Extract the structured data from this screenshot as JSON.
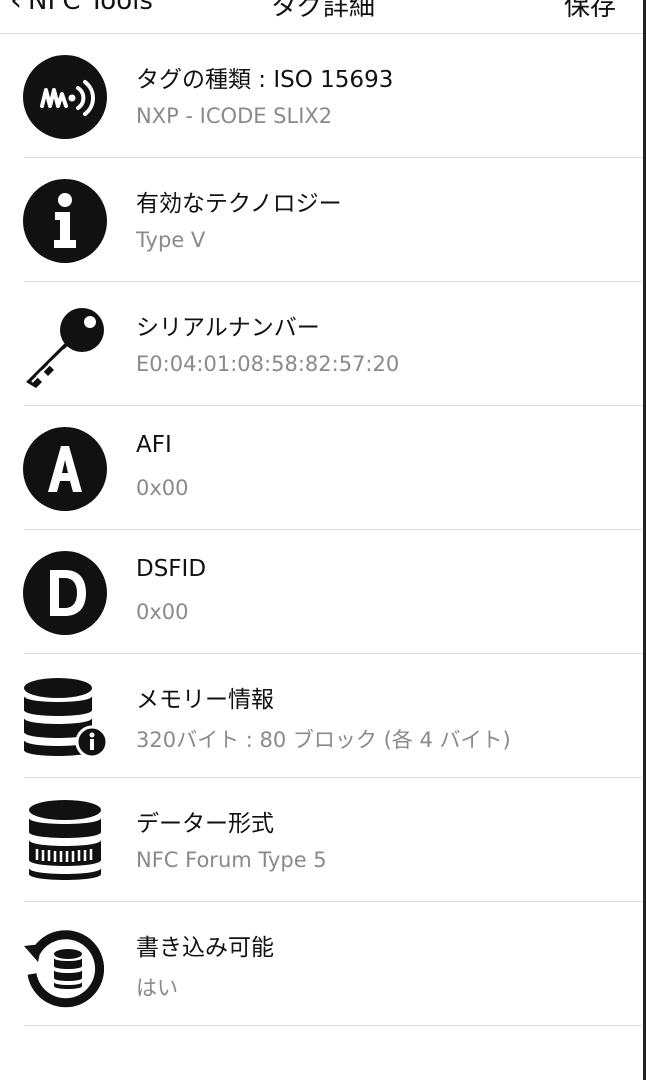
{
  "nav": {
    "back_label": "NFC Tools",
    "title": "タグ詳細",
    "save_label": "保存"
  },
  "rows": [
    {
      "icon": "nfc-signal-icon",
      "label": "タグの種類 : ISO 15693",
      "value": "NXP - ICODE SLIX2"
    },
    {
      "icon": "info-icon",
      "label": "有効なテクノロジー",
      "value": "Type V"
    },
    {
      "icon": "key-icon",
      "label": "シリアルナンバー",
      "value": "E0:04:01:08:58:82:57:20"
    },
    {
      "icon": "letter-a-icon",
      "label": "AFI",
      "value": "0x00"
    },
    {
      "icon": "letter-d-icon",
      "label": "DSFID",
      "value": "0x00"
    },
    {
      "icon": "database-info-icon",
      "label": "メモリー情報",
      "value": "320バイト : 80 ブロック (各 4 バイト)"
    },
    {
      "icon": "database-format-icon",
      "label": "データー形式",
      "value": "NFC Forum Type 5"
    },
    {
      "icon": "database-refresh-icon",
      "label": "書き込み可能",
      "value": "はい"
    }
  ]
}
